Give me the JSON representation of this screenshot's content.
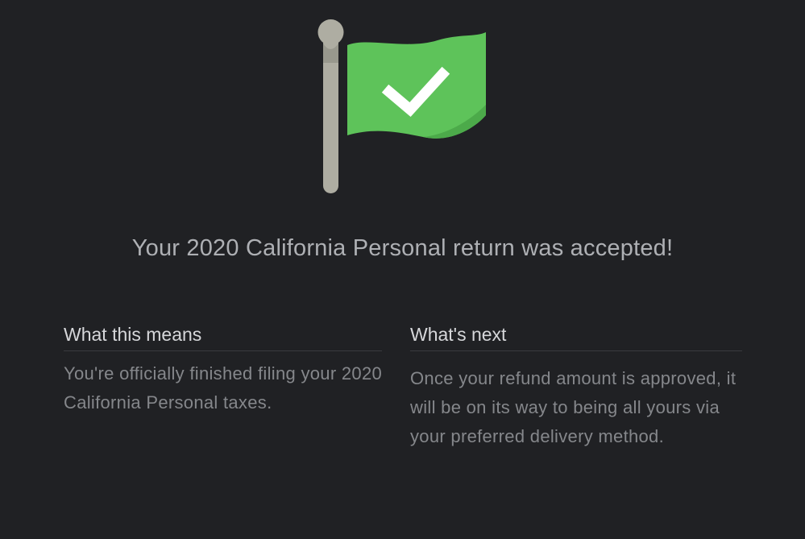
{
  "icons": {
    "status": "green-flag-checkmark-icon"
  },
  "colors": {
    "background": "#202124",
    "flag_green": "#5ec35a",
    "flag_shadow": "#4caa4a",
    "pole": "#aeada2",
    "headline": "#aeb0b4"
  },
  "headline": "Your 2020 California Personal return was accepted!",
  "sections": [
    {
      "title": "What this means",
      "body": "You're officially finished filing your 2020 California Personal taxes."
    },
    {
      "title": "What's next",
      "body": "Once your refund amount is approved, it will be on its way to being all yours via your preferred delivery method."
    }
  ]
}
